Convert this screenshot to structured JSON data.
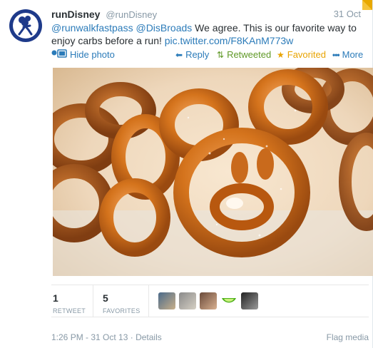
{
  "tweet": {
    "name": "runDisney",
    "handle": "@runDisney",
    "date": "31 Oct",
    "mention1": "@runwalkfastpass",
    "mention2": "@DisBroads",
    "body": " We agree. This is our favorite way to enjoy carbs before a run! ",
    "photo_link": "pic.twitter.com/F8KAnM773w"
  },
  "actions": {
    "hide_photo": "Hide photo",
    "reply": "Reply",
    "retweeted": "Retweeted",
    "favorited": "Favorited",
    "more": "More"
  },
  "stats": {
    "retweets": "1",
    "retweets_label": "RETWEET",
    "favorites": "5",
    "favorites_label": "FAVORITES"
  },
  "footer": {
    "timestamp": "1:26 PM - 31 Oct 13",
    "separator": " · ",
    "details": "Details",
    "flag": "Flag media"
  },
  "colors": {
    "link": "#2b7bb9",
    "retweeted": "#609928",
    "favorited": "#e8a300"
  }
}
